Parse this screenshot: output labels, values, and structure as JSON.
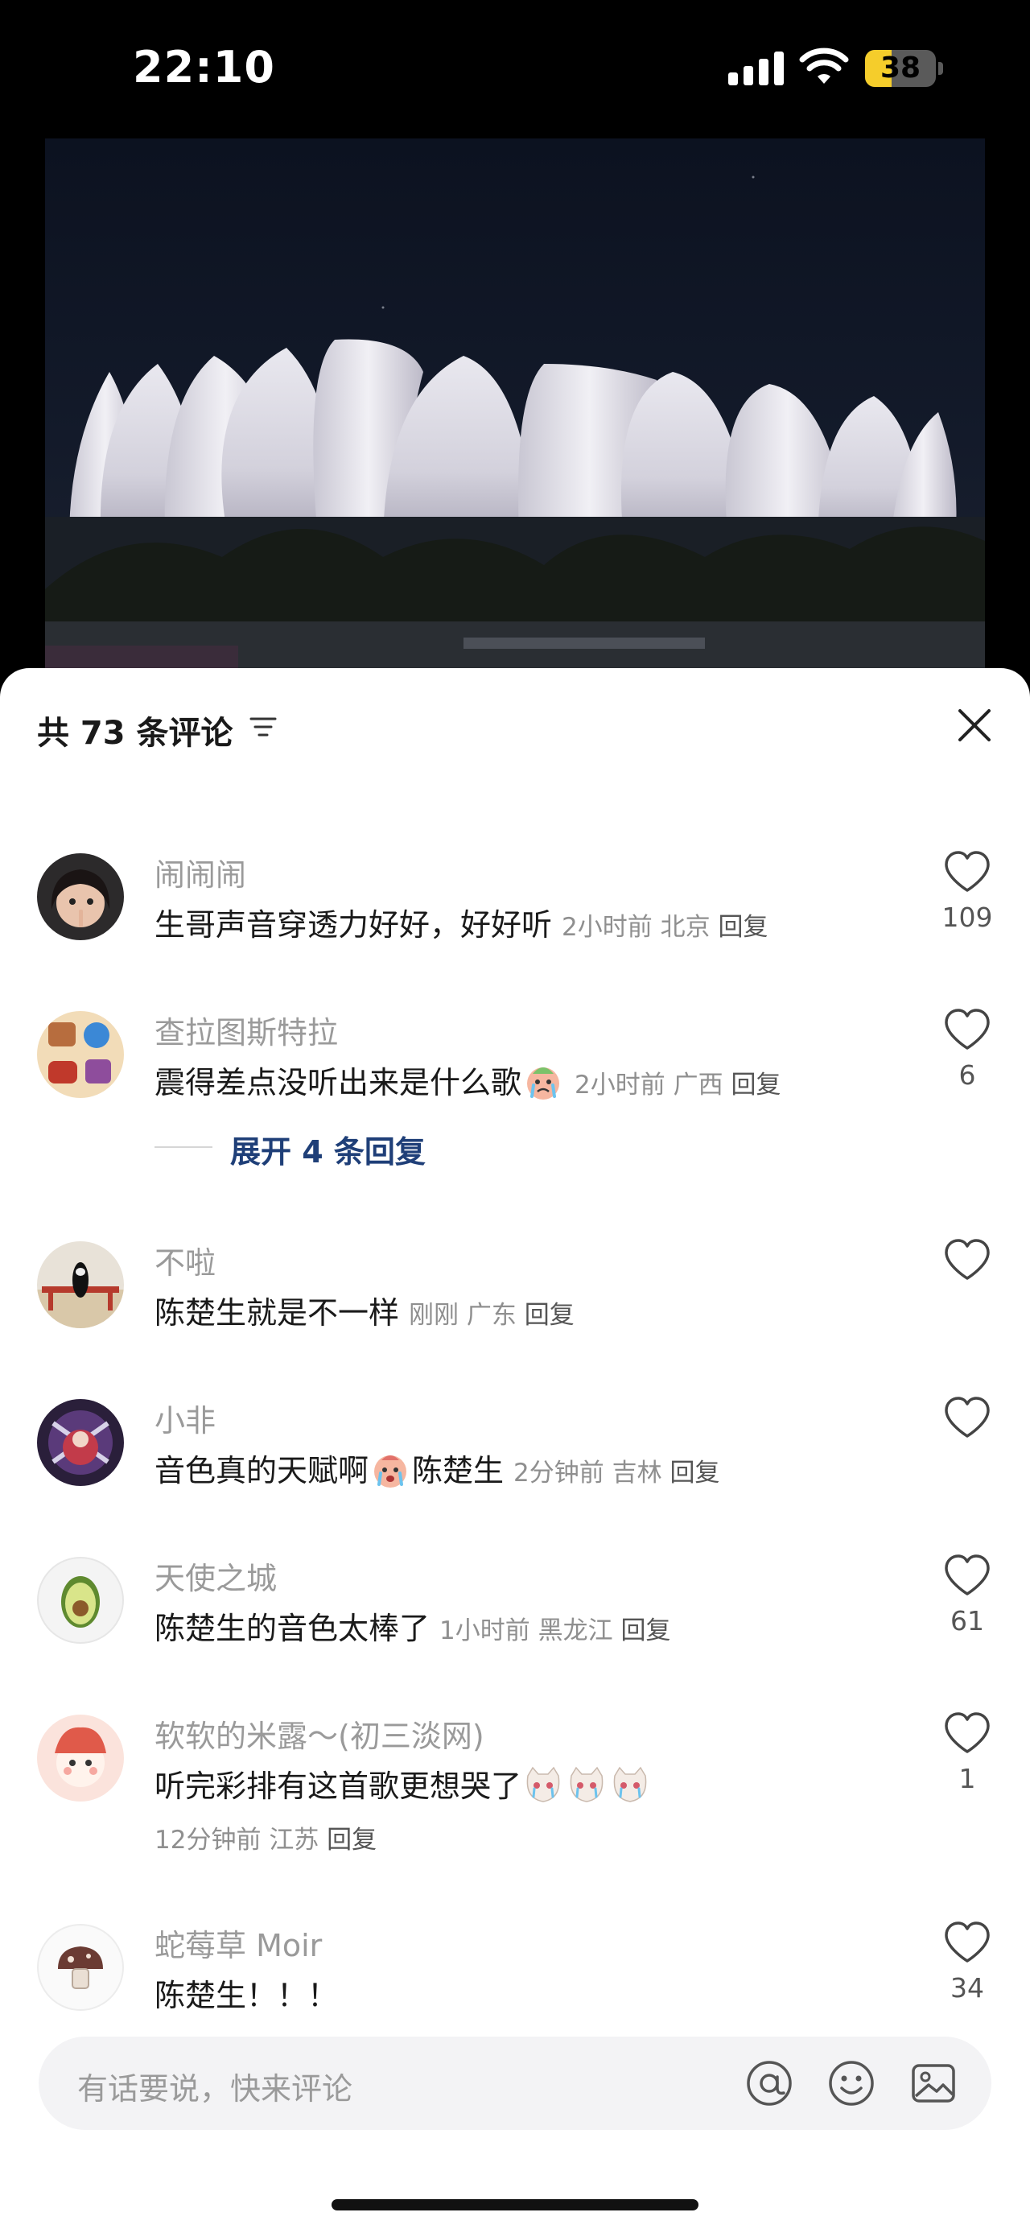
{
  "status_bar": {
    "time": "22:10",
    "battery": "38",
    "battery_level": 0.38
  },
  "sheet": {
    "title": "共 73 条评论"
  },
  "comments": [
    {
      "user": "闹闹闹",
      "text": "生哥声音穿透力好好，好好听",
      "time": "2小时前",
      "location": "北京",
      "reply": "回复",
      "likes": "109"
    },
    {
      "user": "查拉图斯特拉",
      "text": "震得差点没听出来是什么歌",
      "time": "2小时前",
      "location": "广西",
      "reply": "回复",
      "likes": "6",
      "expand": "展开 4 条回复"
    },
    {
      "user": "不啦",
      "text": "陈楚生就是不一样",
      "time": "刚刚",
      "location": "广东",
      "reply": "回复",
      "likes": ""
    },
    {
      "user": "小非",
      "text_a": "音色真的天赋啊",
      "text_b": "陈楚生",
      "time": "2分钟前",
      "location": "吉林",
      "reply": "回复",
      "likes": ""
    },
    {
      "user": "天使之城",
      "text": "陈楚生的音色太棒了",
      "time": "1小时前",
      "location": "黑龙江",
      "reply": "回复",
      "likes": "61"
    },
    {
      "user": "软软的米露～(初三淡网)",
      "text": "听完彩排有这首歌更想哭了",
      "time": "12分钟前",
      "location": "江苏",
      "reply": "回复",
      "likes": "1"
    },
    {
      "user": "蛇莓草 Moir",
      "text": "陈楚生！！！",
      "likes": "34"
    }
  ],
  "input": {
    "placeholder": "有话要说，快来评论"
  },
  "icons": [
    "signal-icon",
    "wifi-icon",
    "battery-icon",
    "sort-icon",
    "close-icon",
    "heart-icon",
    "at-icon",
    "smile-icon",
    "image-icon"
  ]
}
